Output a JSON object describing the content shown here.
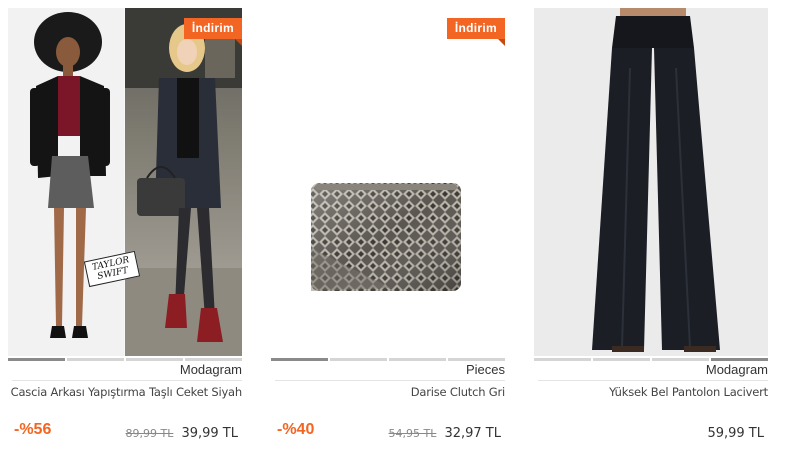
{
  "products": [
    {
      "badge": "İndirim",
      "brand": "Modagram",
      "title": "Cascia Arkası Yapıştırma Taşlı Ceket Siyah",
      "discount": "-%56",
      "old_price": "89,99 TL",
      "new_price": "39,99 TL",
      "image_caption": "TAYLOR SWIFT",
      "slider_active": 1,
      "slider_count": 4
    },
    {
      "badge": "İndirim",
      "brand": "Pieces",
      "title": "Darise Clutch Gri",
      "discount": "-%40",
      "old_price": "54,95 TL",
      "new_price": "32,97 TL",
      "slider_active": 1,
      "slider_count": 4
    },
    {
      "brand": "Modagram",
      "title": "Yüksek Bel Pantolon Lacivert",
      "new_price": "59,99 TL",
      "slider_active": 4,
      "slider_count": 4
    }
  ],
  "colors": {
    "accent": "#f26522",
    "badge_shadow": "#c74a12"
  }
}
